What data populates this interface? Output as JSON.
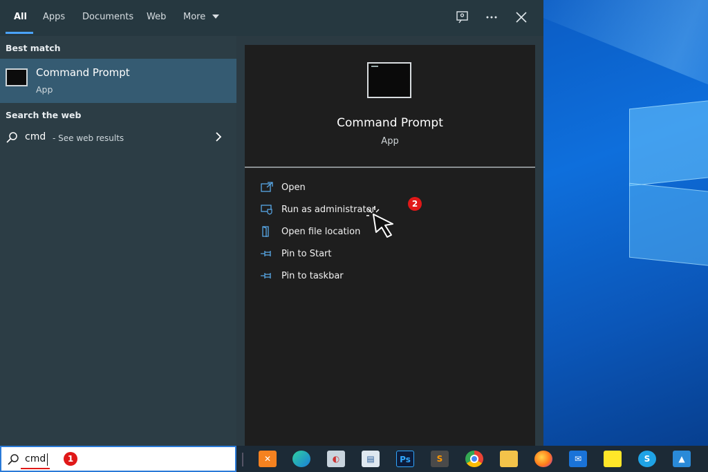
{
  "tabs": [
    {
      "label": "All",
      "active": true
    },
    {
      "label": "Apps"
    },
    {
      "label": "Documents"
    },
    {
      "label": "Web"
    },
    {
      "label": "More"
    }
  ],
  "left": {
    "best_match_heading": "Best match",
    "best_match": {
      "title": "Command Prompt",
      "subtitle": "App",
      "icon": "command-prompt-icon"
    },
    "search_web_heading": "Search the web",
    "web_result": {
      "query": "cmd",
      "suffix": "- See web results"
    }
  },
  "detail": {
    "title": "Command Prompt",
    "subtitle": "App",
    "actions": [
      {
        "label": "Open",
        "icon": "open-icon"
      },
      {
        "label": "Run as administrator",
        "icon": "run-as-admin-icon"
      },
      {
        "label": "Open file location",
        "icon": "file-location-icon"
      },
      {
        "label": "Pin to Start",
        "icon": "pin-icon"
      },
      {
        "label": "Pin to taskbar",
        "icon": "pin-icon"
      }
    ]
  },
  "annotations": {
    "step1": "1",
    "step2": "2",
    "color": "#e01818"
  },
  "search": {
    "value": "cmd"
  },
  "taskbar_apps": [
    "xampp-icon",
    "edge-icon",
    "settings-tool-icon",
    "scanner-icon",
    "photoshop-icon",
    "sublime-text-icon",
    "chrome-icon",
    "file-explorer-icon",
    "firefox-icon",
    "mail-icon",
    "sticky-notes-icon",
    "skype-icon",
    "photos-icon"
  ],
  "colors": {
    "accent": "#4aa3ff",
    "selection": "#355b72",
    "panel": "#1e1e1e"
  }
}
